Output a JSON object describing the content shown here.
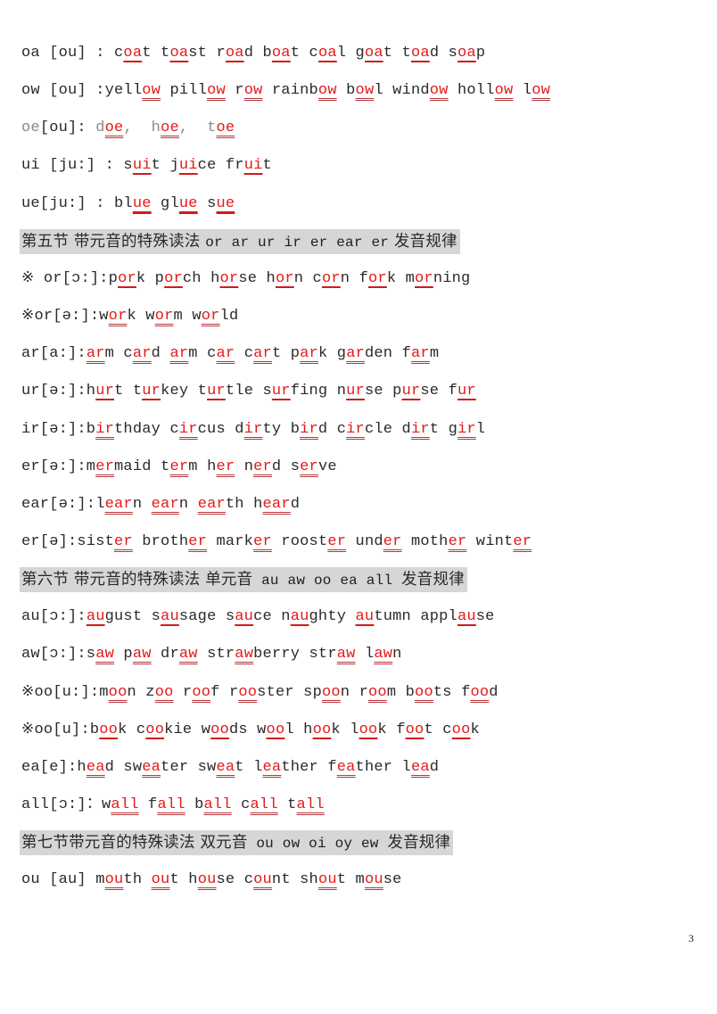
{
  "document": {
    "page_number": "3",
    "lines": [
      {
        "type": "rule",
        "style": "solid",
        "segments": [
          [
            "oa [ou] : c",
            "n"
          ],
          [
            "oa",
            "r"
          ],
          [
            "t t",
            "n"
          ],
          [
            "oa",
            "r"
          ],
          [
            "st r",
            "n"
          ],
          [
            "oa",
            "r"
          ],
          [
            "d b",
            "n"
          ],
          [
            "oa",
            "r"
          ],
          [
            "t c",
            "n"
          ],
          [
            "oa",
            "r"
          ],
          [
            "l g",
            "n"
          ],
          [
            "oa",
            "r"
          ],
          [
            "t t",
            "n"
          ],
          [
            "oa",
            "r"
          ],
          [
            "d s",
            "n"
          ],
          [
            "oa",
            "r"
          ],
          [
            "p",
            "n"
          ]
        ]
      },
      {
        "type": "rule",
        "style": "dotted",
        "segments": [
          [
            "ow [ou] :yell",
            "n"
          ],
          [
            "ow",
            "r"
          ],
          [
            " pill",
            "n"
          ],
          [
            "ow",
            "r"
          ],
          [
            " r",
            "n"
          ],
          [
            "ow",
            "r"
          ],
          [
            " rainb",
            "n"
          ],
          [
            "ow",
            "r"
          ],
          [
            " b",
            "n"
          ],
          [
            "ow",
            "r"
          ],
          [
            "l wind",
            "n"
          ],
          [
            "ow",
            "r"
          ],
          [
            " holl",
            "n"
          ],
          [
            "ow",
            "r"
          ],
          [
            " l",
            "n"
          ],
          [
            "ow",
            "r"
          ]
        ]
      },
      {
        "type": "rule",
        "style": "dotted",
        "segments": [
          [
            "oe",
            "g"
          ],
          [
            "[ou]: ",
            "n"
          ],
          [
            "d",
            "g"
          ],
          [
            "oe",
            "r"
          ],
          [
            ",  ",
            "g"
          ],
          [
            "h",
            "g"
          ],
          [
            "oe",
            "r"
          ],
          [
            ",  ",
            "g"
          ],
          [
            "t",
            "g"
          ],
          [
            "oe",
            "r"
          ]
        ]
      },
      {
        "type": "rule",
        "style": "solid",
        "segments": [
          [
            "ui [ju:] : s",
            "n"
          ],
          [
            "ui",
            "r"
          ],
          [
            "t j",
            "n"
          ],
          [
            "ui",
            "r"
          ],
          [
            "ce fr",
            "n"
          ],
          [
            "ui",
            "r"
          ],
          [
            "t",
            "n"
          ]
        ]
      },
      {
        "type": "rule",
        "style": "thick",
        "segments": [
          [
            "ue[ju:] : bl",
            "n"
          ],
          [
            "ue",
            "r"
          ],
          [
            " gl",
            "n"
          ],
          [
            "ue",
            "r"
          ],
          [
            " s",
            "n"
          ],
          [
            "ue",
            "r"
          ]
        ]
      },
      {
        "type": "heading",
        "segments": [
          [
            "第五节 带元音的特殊读法 ",
            "cjk"
          ],
          [
            "or ar ur ir er ear er",
            "mono"
          ],
          [
            " 发音规律",
            "cjk"
          ]
        ]
      },
      {
        "type": "rule",
        "style": "solid",
        "segments": [
          [
            "※ or[ɔ:]:p",
            "n"
          ],
          [
            "or",
            "r"
          ],
          [
            "k p",
            "n"
          ],
          [
            "or",
            "r"
          ],
          [
            "ch h",
            "n"
          ],
          [
            "or",
            "r"
          ],
          [
            "se h",
            "n"
          ],
          [
            "or",
            "r"
          ],
          [
            "n c",
            "n"
          ],
          [
            "or",
            "r"
          ],
          [
            "n f",
            "n"
          ],
          [
            "or",
            "r"
          ],
          [
            "k m",
            "n"
          ],
          [
            "or",
            "r"
          ],
          [
            "ning",
            "n"
          ]
        ]
      },
      {
        "type": "rule",
        "style": "dotted",
        "segments": [
          [
            "※or[ə:]:w",
            "n"
          ],
          [
            "or",
            "r"
          ],
          [
            "k w",
            "n"
          ],
          [
            "or",
            "r"
          ],
          [
            "m w",
            "n"
          ],
          [
            "or",
            "r"
          ],
          [
            "ld",
            "n"
          ]
        ]
      },
      {
        "type": "rule",
        "style": "dotted",
        "segments": [
          [
            "ar[a:]:",
            "n"
          ],
          [
            "ar",
            "r"
          ],
          [
            "m c",
            "n"
          ],
          [
            "ar",
            "r"
          ],
          [
            "d ",
            "n"
          ],
          [
            "ar",
            "r"
          ],
          [
            "m c",
            "n"
          ],
          [
            "ar",
            "r"
          ],
          [
            " c",
            "n"
          ],
          [
            "ar",
            "r"
          ],
          [
            "t p",
            "n"
          ],
          [
            "ar",
            "r"
          ],
          [
            "k g",
            "n"
          ],
          [
            "ar",
            "r"
          ],
          [
            "den f",
            "n"
          ],
          [
            "ar",
            "r"
          ],
          [
            "m",
            "n"
          ]
        ]
      },
      {
        "type": "rule",
        "style": "solid",
        "segments": [
          [
            "ur[ə:]:h",
            "n"
          ],
          [
            "ur",
            "r"
          ],
          [
            "t t",
            "n"
          ],
          [
            "ur",
            "r"
          ],
          [
            "key t",
            "n"
          ],
          [
            "ur",
            "r"
          ],
          [
            "tle s",
            "n"
          ],
          [
            "ur",
            "r"
          ],
          [
            "fing n",
            "n"
          ],
          [
            "ur",
            "r"
          ],
          [
            "se p",
            "n"
          ],
          [
            "ur",
            "r"
          ],
          [
            "se f",
            "n"
          ],
          [
            "ur",
            "r"
          ]
        ]
      },
      {
        "type": "rule",
        "style": "dotted",
        "segments": [
          [
            "ir[ə:]:b",
            "n"
          ],
          [
            "ir",
            "r"
          ],
          [
            "thday c",
            "n"
          ],
          [
            "ir",
            "r"
          ],
          [
            "cus d",
            "n"
          ],
          [
            "ir",
            "r"
          ],
          [
            "ty b",
            "n"
          ],
          [
            "ir",
            "r"
          ],
          [
            "d c",
            "n"
          ],
          [
            "ir",
            "r"
          ],
          [
            "cle d",
            "n"
          ],
          [
            "ir",
            "r"
          ],
          [
            "t g",
            "n"
          ],
          [
            "ir",
            "r"
          ],
          [
            "l",
            "n"
          ]
        ]
      },
      {
        "type": "rule",
        "style": "dotted",
        "segments": [
          [
            "er[ə:]:m",
            "n"
          ],
          [
            "er",
            "r"
          ],
          [
            "maid t",
            "n"
          ],
          [
            "er",
            "r"
          ],
          [
            "m h",
            "n"
          ],
          [
            "er",
            "r"
          ],
          [
            " n",
            "n"
          ],
          [
            "er",
            "r"
          ],
          [
            "d s",
            "n"
          ],
          [
            "er",
            "r"
          ],
          [
            "ve",
            "n"
          ]
        ]
      },
      {
        "type": "rule",
        "style": "dotted",
        "segments": [
          [
            "ear[ə:]:l",
            "n"
          ],
          [
            "ear",
            "r"
          ],
          [
            "n ",
            "n"
          ],
          [
            "ear",
            "r"
          ],
          [
            "n ",
            "n"
          ],
          [
            "ear",
            "r"
          ],
          [
            "th h",
            "n"
          ],
          [
            "ear",
            "r"
          ],
          [
            "d",
            "n"
          ]
        ]
      },
      {
        "type": "rule",
        "style": "dotted",
        "segments": [
          [
            "er[ə]:sist",
            "n"
          ],
          [
            "er",
            "r"
          ],
          [
            " broth",
            "n"
          ],
          [
            "er",
            "r"
          ],
          [
            " mark",
            "n"
          ],
          [
            "er",
            "r"
          ],
          [
            " roost",
            "n"
          ],
          [
            "er",
            "r"
          ],
          [
            " und",
            "n"
          ],
          [
            "er",
            "r"
          ],
          [
            " moth",
            "n"
          ],
          [
            "er",
            "r"
          ],
          [
            " wint",
            "n"
          ],
          [
            "er",
            "r"
          ]
        ]
      },
      {
        "type": "heading",
        "segments": [
          [
            "第六节 带元音的特殊读法 单元音",
            "cjk"
          ],
          [
            " au aw oo ea all ",
            "mono"
          ],
          [
            "发音规律",
            "cjk"
          ]
        ]
      },
      {
        "type": "rule",
        "style": "solid",
        "segments": [
          [
            "au[ɔ:]:",
            "n"
          ],
          [
            "au",
            "r"
          ],
          [
            "gust s",
            "n"
          ],
          [
            "au",
            "r"
          ],
          [
            "sage s",
            "n"
          ],
          [
            "au",
            "r"
          ],
          [
            "ce n",
            "n"
          ],
          [
            "au",
            "r"
          ],
          [
            "ghty ",
            "n"
          ],
          [
            "au",
            "r"
          ],
          [
            "tumn appl",
            "n"
          ],
          [
            "au",
            "r"
          ],
          [
            "se",
            "n"
          ]
        ]
      },
      {
        "type": "rule",
        "style": "dotted",
        "segments": [
          [
            "aw[ɔ:]:s",
            "n"
          ],
          [
            "aw",
            "r"
          ],
          [
            " p",
            "n"
          ],
          [
            "aw",
            "r"
          ],
          [
            " dr",
            "n"
          ],
          [
            "aw",
            "r"
          ],
          [
            " str",
            "n"
          ],
          [
            "aw",
            "r"
          ],
          [
            "berry str",
            "n"
          ],
          [
            "aw",
            "r"
          ],
          [
            " l",
            "n"
          ],
          [
            "aw",
            "r"
          ],
          [
            "n",
            "n"
          ]
        ]
      },
      {
        "type": "rule",
        "style": "dotted",
        "segments": [
          [
            "※oo[u:]:m",
            "n"
          ],
          [
            "oo",
            "r"
          ],
          [
            "n z",
            "n"
          ],
          [
            "oo",
            "r"
          ],
          [
            " r",
            "n"
          ],
          [
            "oo",
            "r"
          ],
          [
            "f r",
            "n"
          ],
          [
            "oo",
            "r"
          ],
          [
            "ster sp",
            "n"
          ],
          [
            "oo",
            "r"
          ],
          [
            "n r",
            "n"
          ],
          [
            "oo",
            "r"
          ],
          [
            "m b",
            "n"
          ],
          [
            "oo",
            "r"
          ],
          [
            "ts f",
            "n"
          ],
          [
            "oo",
            "r"
          ],
          [
            "d",
            "n"
          ]
        ]
      },
      {
        "type": "rule",
        "style": "solid",
        "segments": [
          [
            "※oo[u]:b",
            "n"
          ],
          [
            "oo",
            "r"
          ],
          [
            "k c",
            "n"
          ],
          [
            "oo",
            "r"
          ],
          [
            "kie w",
            "n"
          ],
          [
            "oo",
            "r"
          ],
          [
            "ds w",
            "n"
          ],
          [
            "oo",
            "r"
          ],
          [
            "l h",
            "n"
          ],
          [
            "oo",
            "r"
          ],
          [
            "k l",
            "n"
          ],
          [
            "oo",
            "r"
          ],
          [
            "k f",
            "n"
          ],
          [
            "oo",
            "r"
          ],
          [
            "t c",
            "n"
          ],
          [
            "oo",
            "r"
          ],
          [
            "k",
            "n"
          ]
        ]
      },
      {
        "type": "rule",
        "style": "dotted",
        "segments": [
          [
            "ea[e]:h",
            "n"
          ],
          [
            "ea",
            "r"
          ],
          [
            "d sw",
            "n"
          ],
          [
            "ea",
            "r"
          ],
          [
            "ter sw",
            "n"
          ],
          [
            "ea",
            "r"
          ],
          [
            "t l",
            "n"
          ],
          [
            "ea",
            "r"
          ],
          [
            "ther f",
            "n"
          ],
          [
            "ea",
            "r"
          ],
          [
            "ther l",
            "n"
          ],
          [
            "ea",
            "r"
          ],
          [
            "d",
            "n"
          ]
        ]
      },
      {
        "type": "rule",
        "style": "dotted",
        "segments": [
          [
            "all[ɔ:]：w",
            "n"
          ],
          [
            "all",
            "r"
          ],
          [
            " f",
            "n"
          ],
          [
            "all",
            "r"
          ],
          [
            " b",
            "n"
          ],
          [
            "all",
            "r"
          ],
          [
            " c",
            "n"
          ],
          [
            "all",
            "r"
          ],
          [
            " t",
            "n"
          ],
          [
            "all",
            "r"
          ]
        ]
      },
      {
        "type": "heading",
        "segments": [
          [
            "第七节带元音的特殊读法 双元音",
            "cjk"
          ],
          [
            " ou ow oi oy ew ",
            "mono"
          ],
          [
            "发音规律",
            "cjk"
          ]
        ]
      },
      {
        "type": "rule",
        "style": "dotted",
        "segments": [
          [
            "ou [au] m",
            "n"
          ],
          [
            "ou",
            "r"
          ],
          [
            "th ",
            "n"
          ],
          [
            "ou",
            "r"
          ],
          [
            "t h",
            "n"
          ],
          [
            "ou",
            "r"
          ],
          [
            "se c",
            "n"
          ],
          [
            "ou",
            "r"
          ],
          [
            "nt sh",
            "n"
          ],
          [
            "ou",
            "r"
          ],
          [
            "t m",
            "n"
          ],
          [
            "ou",
            "r"
          ],
          [
            "se",
            "n"
          ]
        ]
      }
    ]
  }
}
